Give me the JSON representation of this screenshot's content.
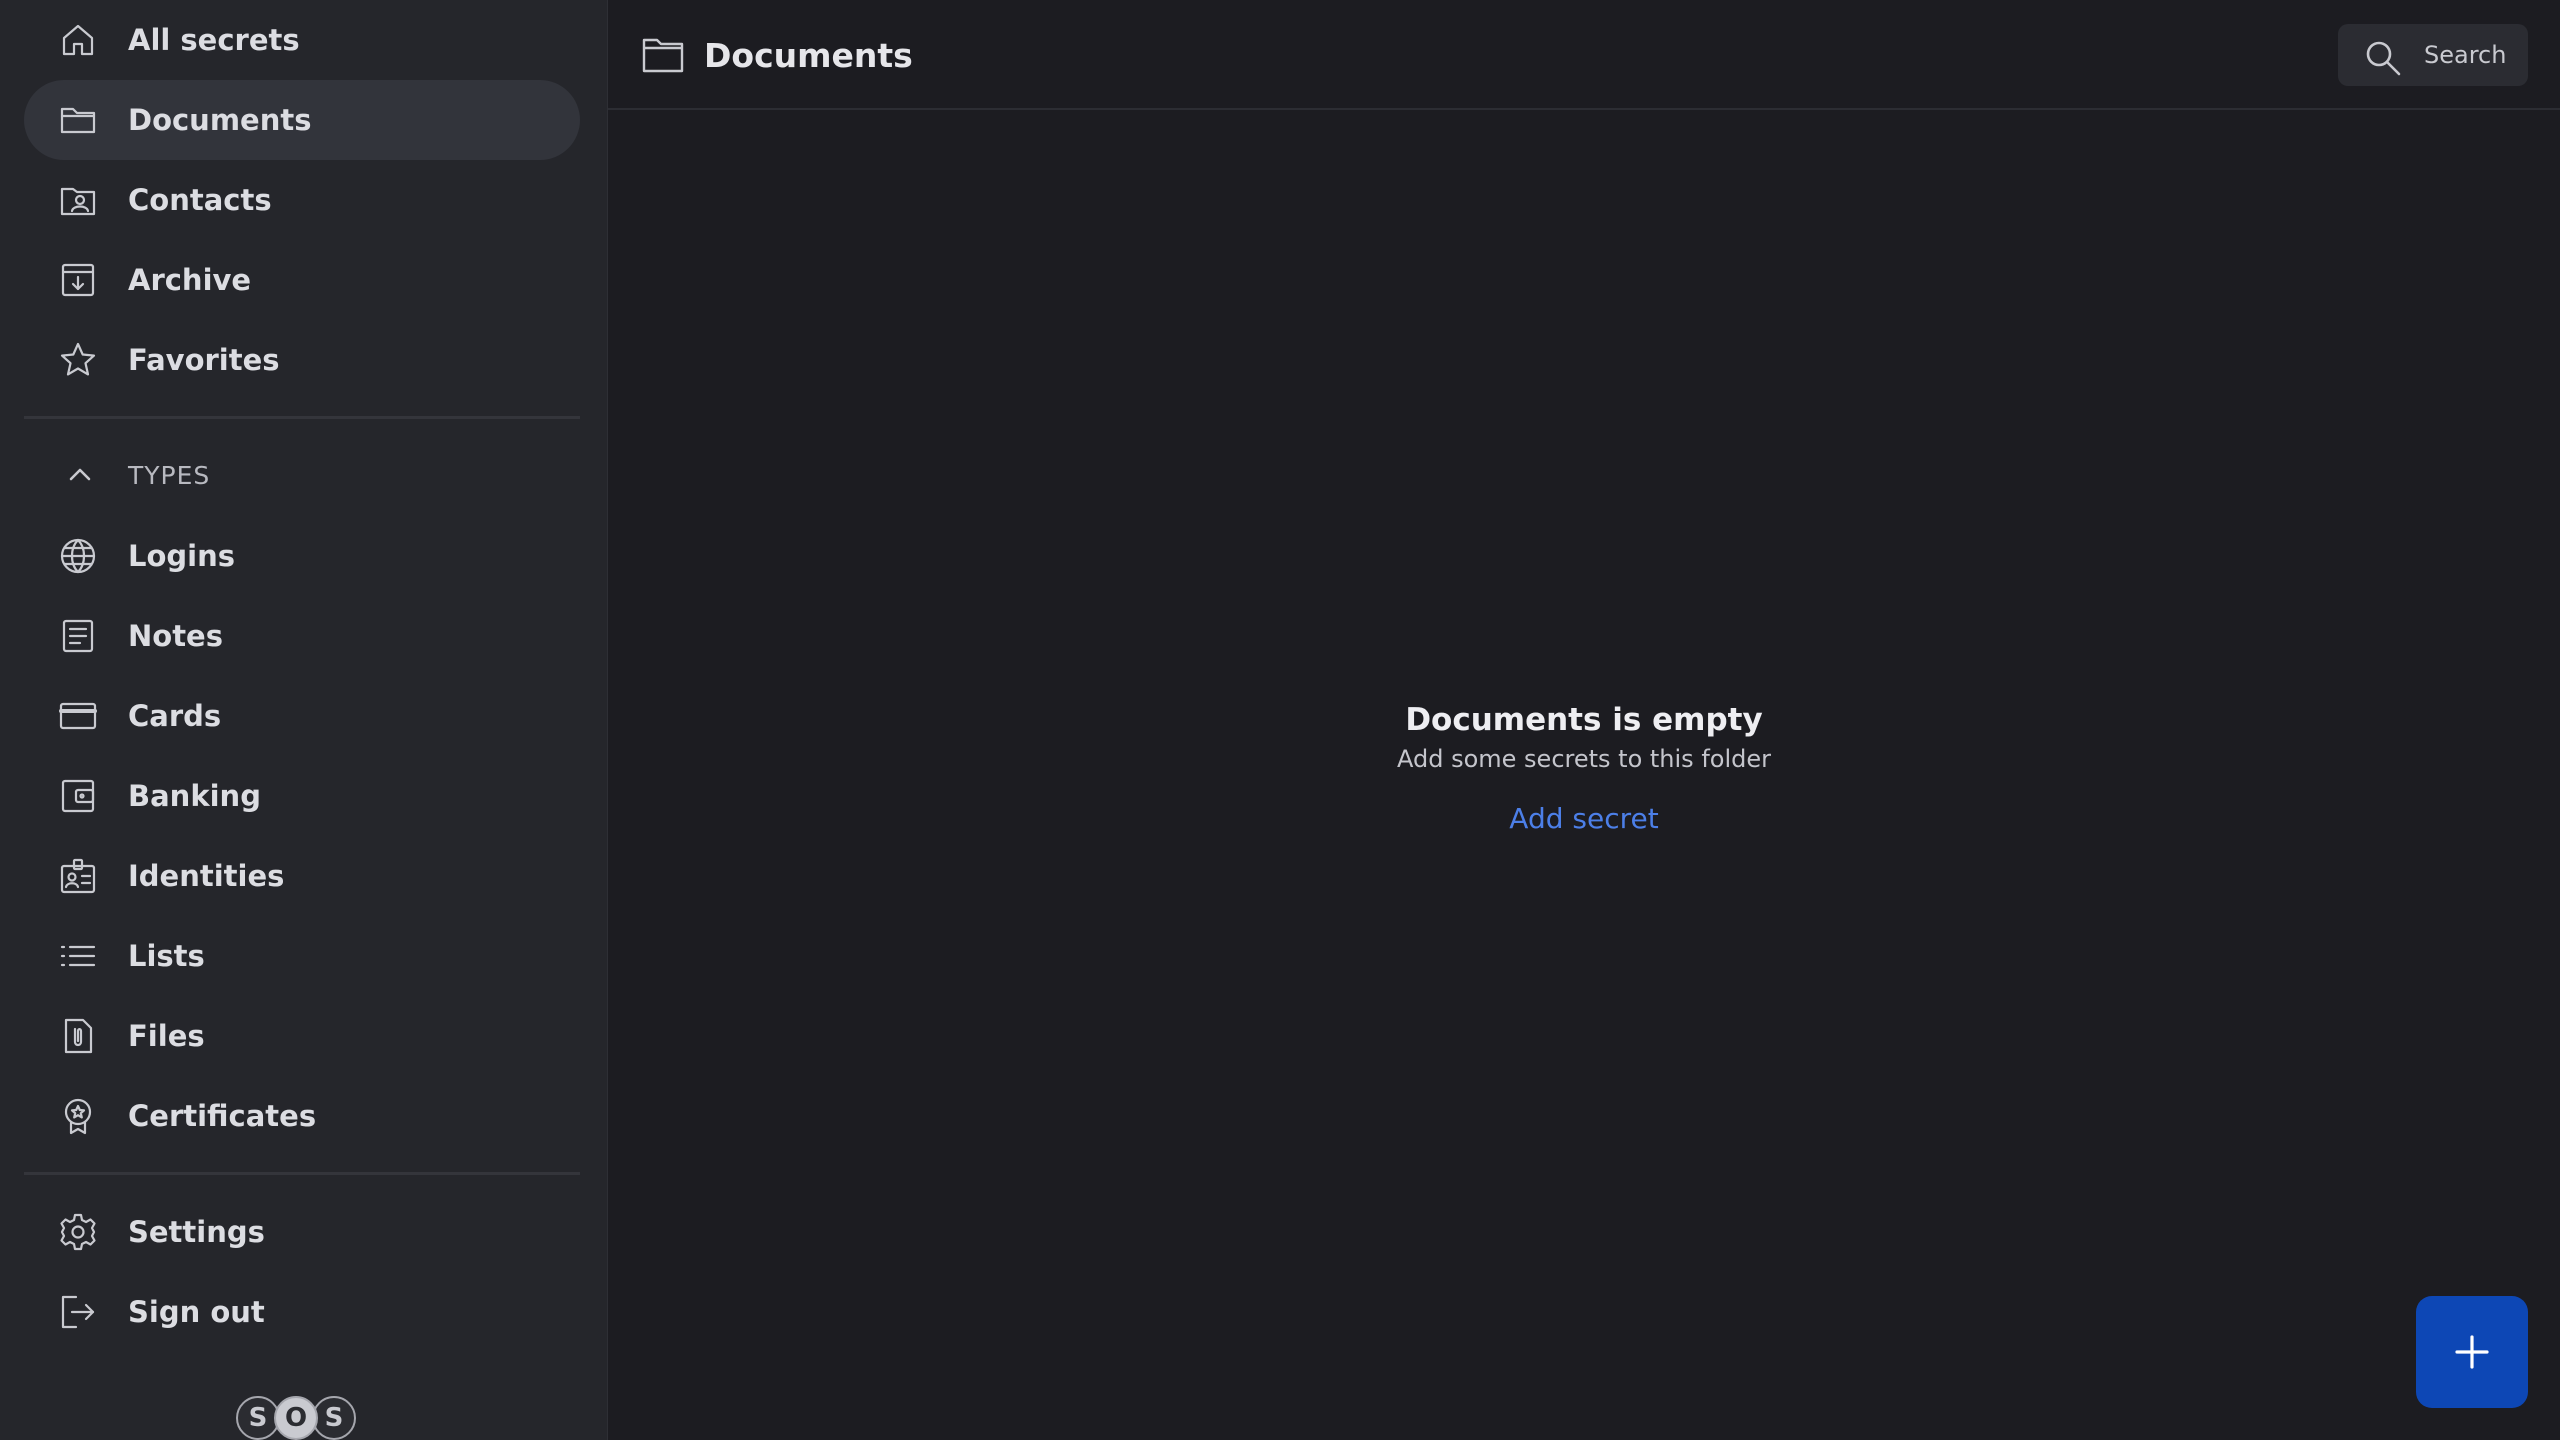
{
  "sidebar": {
    "primary": [
      {
        "label": "All secrets",
        "icon": "home-icon"
      },
      {
        "label": "Documents",
        "icon": "folder-icon",
        "active": true
      },
      {
        "label": "Contacts",
        "icon": "contacts-icon"
      },
      {
        "label": "Archive",
        "icon": "archive-icon"
      },
      {
        "label": "Favorites",
        "icon": "star-icon"
      }
    ],
    "types_header": "TYPES",
    "types": [
      {
        "label": "Logins",
        "icon": "globe-icon"
      },
      {
        "label": "Notes",
        "icon": "note-icon"
      },
      {
        "label": "Cards",
        "icon": "credit-card-icon"
      },
      {
        "label": "Banking",
        "icon": "wallet-icon"
      },
      {
        "label": "Identities",
        "icon": "id-badge-icon"
      },
      {
        "label": "Lists",
        "icon": "list-icon"
      },
      {
        "label": "Files",
        "icon": "paperclip-file-icon"
      },
      {
        "label": "Certificates",
        "icon": "award-icon"
      }
    ],
    "footer": [
      {
        "label": "Settings",
        "icon": "gear-icon"
      },
      {
        "label": "Sign out",
        "icon": "sign-out-icon"
      }
    ],
    "logo_letters": [
      "S",
      "O",
      "S"
    ]
  },
  "header": {
    "title": "Documents",
    "search_label": "Search"
  },
  "empty_state": {
    "heading": "Documents is empty",
    "subtext": "Add some secrets to this folder",
    "action_label": "Add secret"
  },
  "colors": {
    "sidebar_bg": "#25262b",
    "main_bg": "#1c1c21",
    "active_item_bg": "#32343b",
    "link": "#4c7fe8",
    "fab": "#0d47b5"
  }
}
